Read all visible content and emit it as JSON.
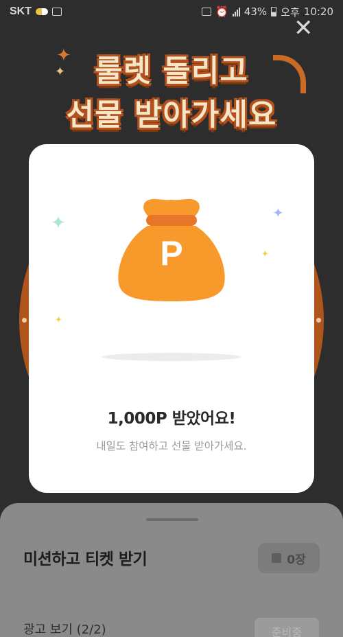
{
  "status_bar": {
    "carrier": "SKT",
    "battery_percent": "43%",
    "ampm": "오후",
    "time": "10:20",
    "icons": [
      "pill-icon",
      "lte-icon",
      "vibrate-icon",
      "alarm-icon",
      "signal-icon",
      "battery-icon"
    ]
  },
  "close_icon": "close-icon",
  "banner": {
    "line1": "룰렛 돌리고",
    "line2": "선물 받아가세요"
  },
  "modal": {
    "bag_letter": "P",
    "title": "1,000P 받았어요!",
    "subtitle": "내일도 참여하고 선물 받아가세요.",
    "colors": {
      "bag": "#f79a2b",
      "bag_band": "#e8762a",
      "mint": "#a8e6d6",
      "blue": "#a6b8f2",
      "yellow": "#f5cf4a"
    }
  },
  "sheet": {
    "title": "미션하고 티켓 받기",
    "ticket_count": "0장",
    "ad_label": "광고 보기 (2/2)",
    "ad_button": "준비중"
  }
}
